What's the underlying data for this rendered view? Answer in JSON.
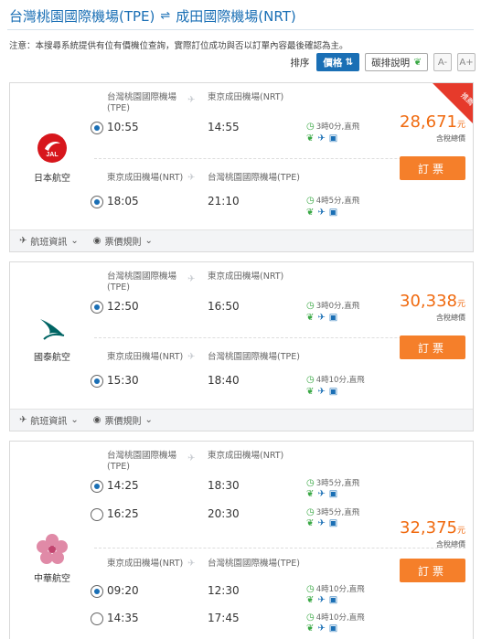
{
  "header": {
    "origin": "台灣桃園國際機場(TPE)",
    "swap_icon": "⇌",
    "destination": "成田國際機場(NRT)"
  },
  "notice": "注意：本搜尋系統提供有位有價機位查詢，實際訂位成功與否以訂單內容最後確認為主。",
  "sort": {
    "label": "排序",
    "price": "價格",
    "eco": "碳排說明",
    "font_smaller": "A-",
    "font_larger": "A+"
  },
  "cards": [
    {
      "airline": "日本航空",
      "badge": "推薦",
      "price": "28,671",
      "unit": "元",
      "tax": "含稅總價",
      "book": "訂票",
      "foot": {
        "info": "航班資訊",
        "rule": "票價規則"
      },
      "outbound": {
        "from": "台灣桃園國際機場(TPE)",
        "to": "東京成田機場(NRT)",
        "dep": "10:55",
        "arr": "14:55",
        "dur": "3時0分,直飛"
      },
      "inbound": {
        "from": "東京成田機場(NRT)",
        "to": "台灣桃園國際機場(TPE)",
        "dep": "18:05",
        "arr": "21:10",
        "dur": "4時5分,直飛"
      }
    },
    {
      "airline": "國泰航空",
      "price": "30,338",
      "unit": "元",
      "tax": "含稅總價",
      "book": "訂票",
      "foot": {
        "info": "航班資訊",
        "rule": "票價規則"
      },
      "outbound": {
        "from": "台灣桃園國際機場(TPE)",
        "to": "東京成田機場(NRT)",
        "dep": "12:50",
        "arr": "16:50",
        "dur": "3時0分,直飛"
      },
      "inbound": {
        "from": "東京成田機場(NRT)",
        "to": "台灣桃園國際機場(TPE)",
        "dep": "15:30",
        "arr": "18:40",
        "dur": "4時10分,直飛"
      }
    },
    {
      "airline": "中華航空",
      "price": "32,375",
      "unit": "元",
      "tax": "含稅總價",
      "book": "訂票",
      "outbound": {
        "from": "台灣桃園國際機場(TPE)",
        "to": "東京成田機場(NRT)",
        "options": [
          {
            "dep": "14:25",
            "arr": "18:30",
            "dur": "3時5分,直飛"
          },
          {
            "dep": "16:25",
            "arr": "20:30",
            "dur": "3時5分,直飛"
          }
        ]
      },
      "inbound": {
        "from": "東京成田機場(NRT)",
        "to": "台灣桃園國際機場(TPE)",
        "options": [
          {
            "dep": "09:20",
            "arr": "12:30",
            "dur": "4時10分,直飛"
          },
          {
            "dep": "14:35",
            "arr": "17:45",
            "dur": "4時10分,直飛"
          }
        ]
      }
    }
  ]
}
